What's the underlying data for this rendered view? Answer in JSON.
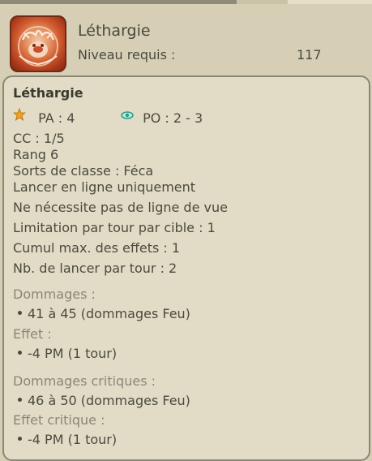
{
  "header": {
    "title": "Léthargie",
    "niveau_label": "Niveau requis :",
    "niveau_value": "117"
  },
  "panel": {
    "title": "Léthargie",
    "pa": "PA : 4",
    "po": "PO : 2 - 3",
    "cc": "CC : 1/5",
    "rang": "Rang 6",
    "sorts_classe": "Sorts de classe : Féca",
    "lancer_ligne": "Lancer en ligne uniquement",
    "ligne_vue": "Ne nécessite pas de ligne de vue",
    "limitation": "Limitation par tour par cible : 1",
    "cumul": "Cumul max. des effets : 1",
    "nb_lancer": "Nb. de lancer par tour : 2",
    "dommages_label": "Dommages :",
    "dommages_value": "41 à 45 (dommages Feu)",
    "effet_label": "Effet :",
    "effet_value": "-4 PM (1 tour)",
    "dommages_crit_label": "Dommages critiques :",
    "dommages_crit_value": "46 à 50 (dommages Feu)",
    "effet_crit_label": "Effet critique :",
    "effet_crit_value": "-4 PM (1 tour)"
  },
  "icons": {
    "spell": "lethargie-spell-icon",
    "pa": "star-icon",
    "po": "eye-icon"
  },
  "colors": {
    "background": "#d6cfb6",
    "panel": "#e2dcc6",
    "text": "#4a4a3e",
    "section_label": "#8a8778",
    "star": "#f0a21c",
    "eye": "#2a9a86"
  }
}
